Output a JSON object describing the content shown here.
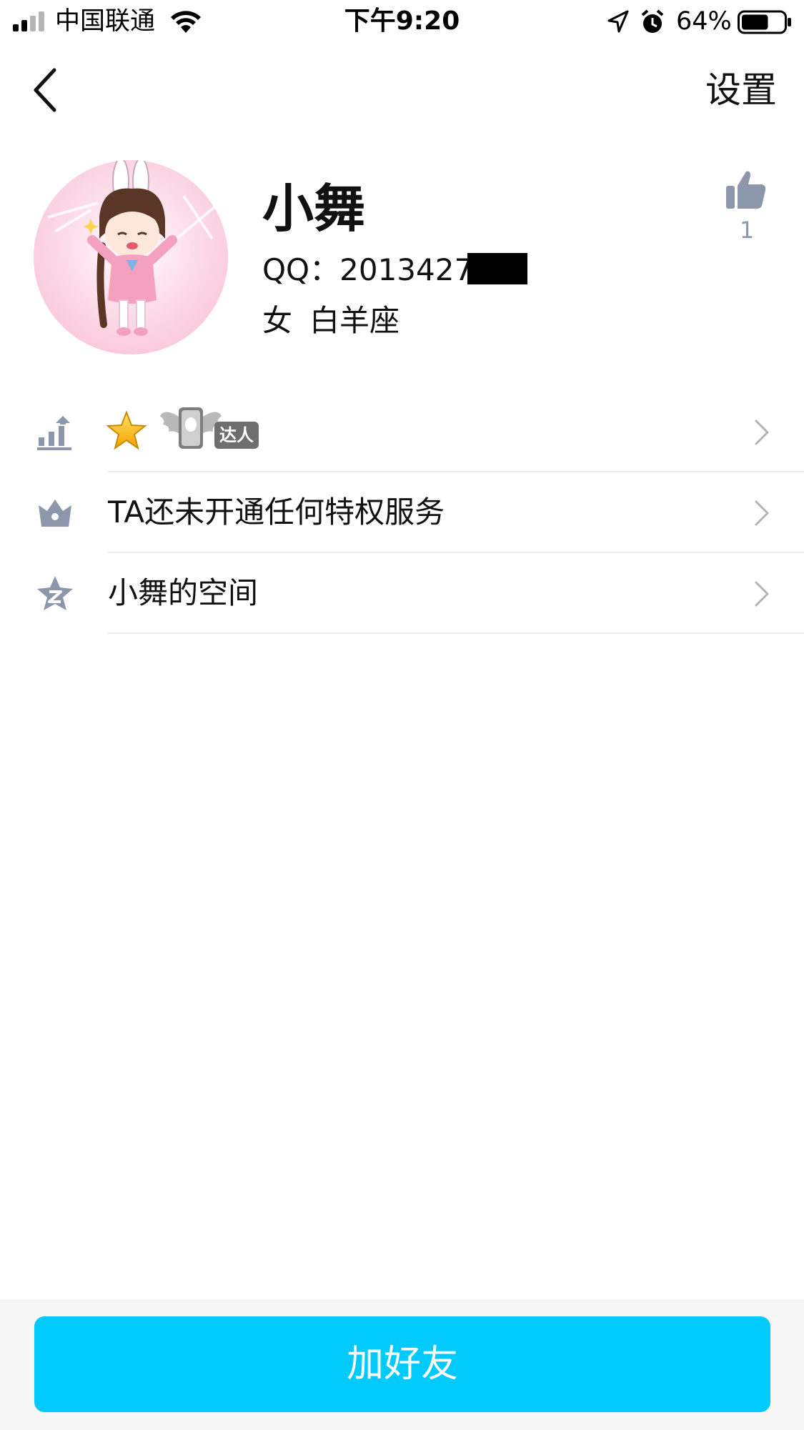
{
  "status_bar": {
    "carrier": "中国联通",
    "time": "下午9:20",
    "battery_percent": "64%",
    "battery_level": 0.64,
    "icons": [
      "signal-icon",
      "wifi-icon",
      "location-icon",
      "alarm-icon",
      "battery-icon"
    ]
  },
  "nav": {
    "back_icon": "chevron-left-icon",
    "settings_label": "设置"
  },
  "profile": {
    "name": "小舞",
    "qq_label": "QQ：",
    "qq_number_visible": "2013427",
    "gender": "女",
    "zodiac": "白羊座",
    "like_count": "1",
    "like_icon": "thumbs-up-icon"
  },
  "list": {
    "items": [
      {
        "icon": "level-bars-icon",
        "label": "",
        "badges": [
          "star-icon",
          "qq-talent-badge"
        ],
        "badge_text": "达人"
      },
      {
        "icon": "crown-icon",
        "label": "TA还未开通任何特权服务"
      },
      {
        "icon": "qzone-star-icon",
        "label": "小舞的空间"
      }
    ]
  },
  "footer": {
    "add_friend_label": "加好友"
  },
  "colors": {
    "accent": "#00cafc",
    "icon_gray": "#8c97ac",
    "divider": "#ececec",
    "bottom_bar_bg": "#f7f7f7"
  }
}
